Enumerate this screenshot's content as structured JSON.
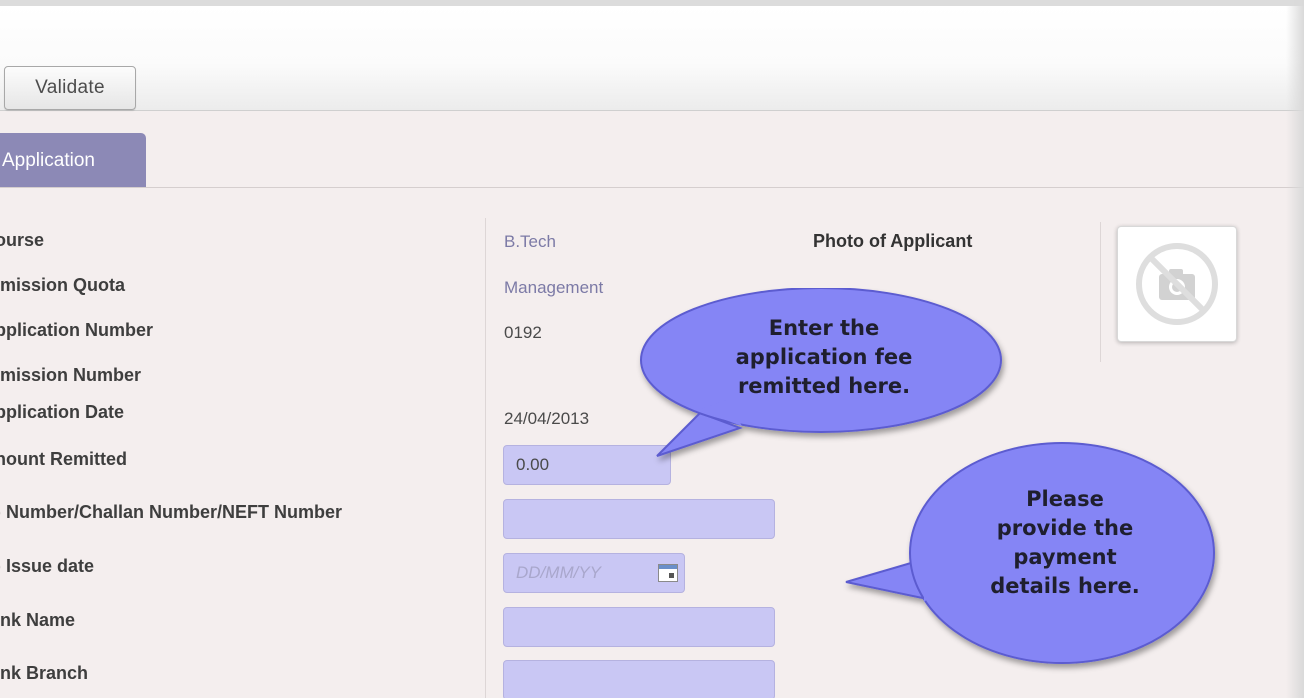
{
  "toolbar": {
    "validate_label": "Validate"
  },
  "tabs": [
    {
      "label": "Application"
    }
  ],
  "form": {
    "labels": {
      "course": "ourse",
      "admission_quota": "lmission Quota",
      "application_number": "pplication Number",
      "admission_number": "lmission Number",
      "application_date": "pplication Date",
      "amount_remitted": "nount Remitted",
      "dd_number": ") Number/Challan Number/NEFT Number",
      "dd_issue_date": ") Issue date",
      "bank_name": "ink Name",
      "bank_branch": "ink Branch"
    },
    "values": {
      "course": "B.Tech",
      "admission_quota": "Management",
      "application_number": "0192",
      "admission_number": "",
      "application_date": "24/04/2013",
      "amount_remitted": "0.00",
      "dd_number": "",
      "bank_name": "",
      "bank_branch": ""
    },
    "dd_issue_date_placeholder": "DD/MM/YY"
  },
  "photo": {
    "label": "Photo of Applicant",
    "icon": "no-camera-icon"
  },
  "callouts": {
    "fee": [
      "Enter the",
      "application fee",
      "remitted here."
    ],
    "payment": [
      "Please",
      "provide the",
      "payment",
      "details here."
    ]
  },
  "colors": {
    "tab_active": "#8c89b6",
    "input_fill": "#c9c7f4",
    "callout_fill": "#8585f5",
    "link_value": "#7c7aa6",
    "page_bg": "#f4eeee"
  }
}
